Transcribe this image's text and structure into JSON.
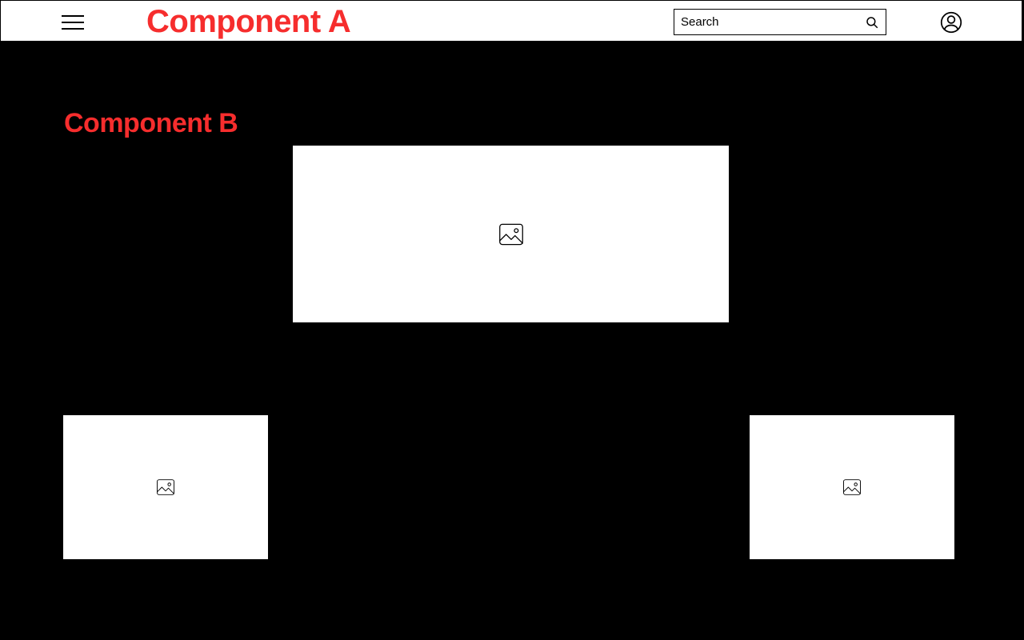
{
  "header": {
    "title": "Component A",
    "search": {
      "placeholder": "Search",
      "value": ""
    }
  },
  "section": {
    "title": "Component B"
  }
}
